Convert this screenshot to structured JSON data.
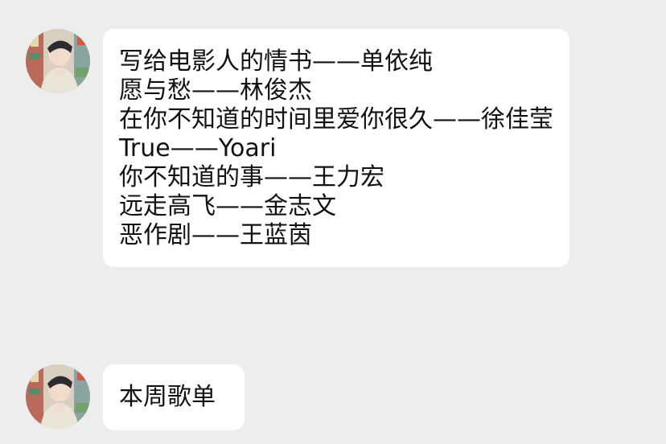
{
  "messages": [
    {
      "lines": [
        "写给电影人的情书——单依纯",
        "愿与愁——林俊杰",
        "在你不知道的时间里爱你很久——徐佳莹",
        "True——Yoari",
        "你不知道的事——王力宏",
        "远走高飞——金志文",
        "恶作剧——王蓝茵"
      ]
    },
    {
      "lines": [
        "本周歌单"
      ]
    }
  ]
}
